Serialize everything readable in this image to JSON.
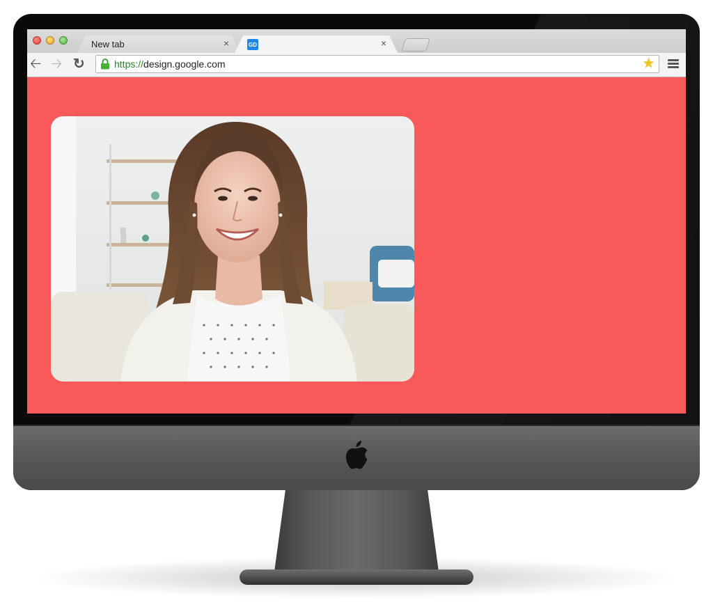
{
  "browser": {
    "tabs": [
      {
        "label": "New tab",
        "close": "×"
      },
      {
        "label": "",
        "favicon_text": "GD",
        "close": "×"
      }
    ],
    "address_bar": {
      "scheme": "https://",
      "host": "design.google.com"
    },
    "icons": {
      "back": "back-arrow-icon",
      "forward": "forward-arrow-icon",
      "reload": "reload-icon",
      "lock": "lock-icon",
      "bookmark": "star-icon",
      "menu": "menu-icon"
    }
  },
  "page": {
    "background_color": "#f95a59",
    "video_card": {
      "content": "video-call-participant"
    }
  },
  "device": {
    "type": "desktop-monitor",
    "logo": "apple-logo"
  }
}
